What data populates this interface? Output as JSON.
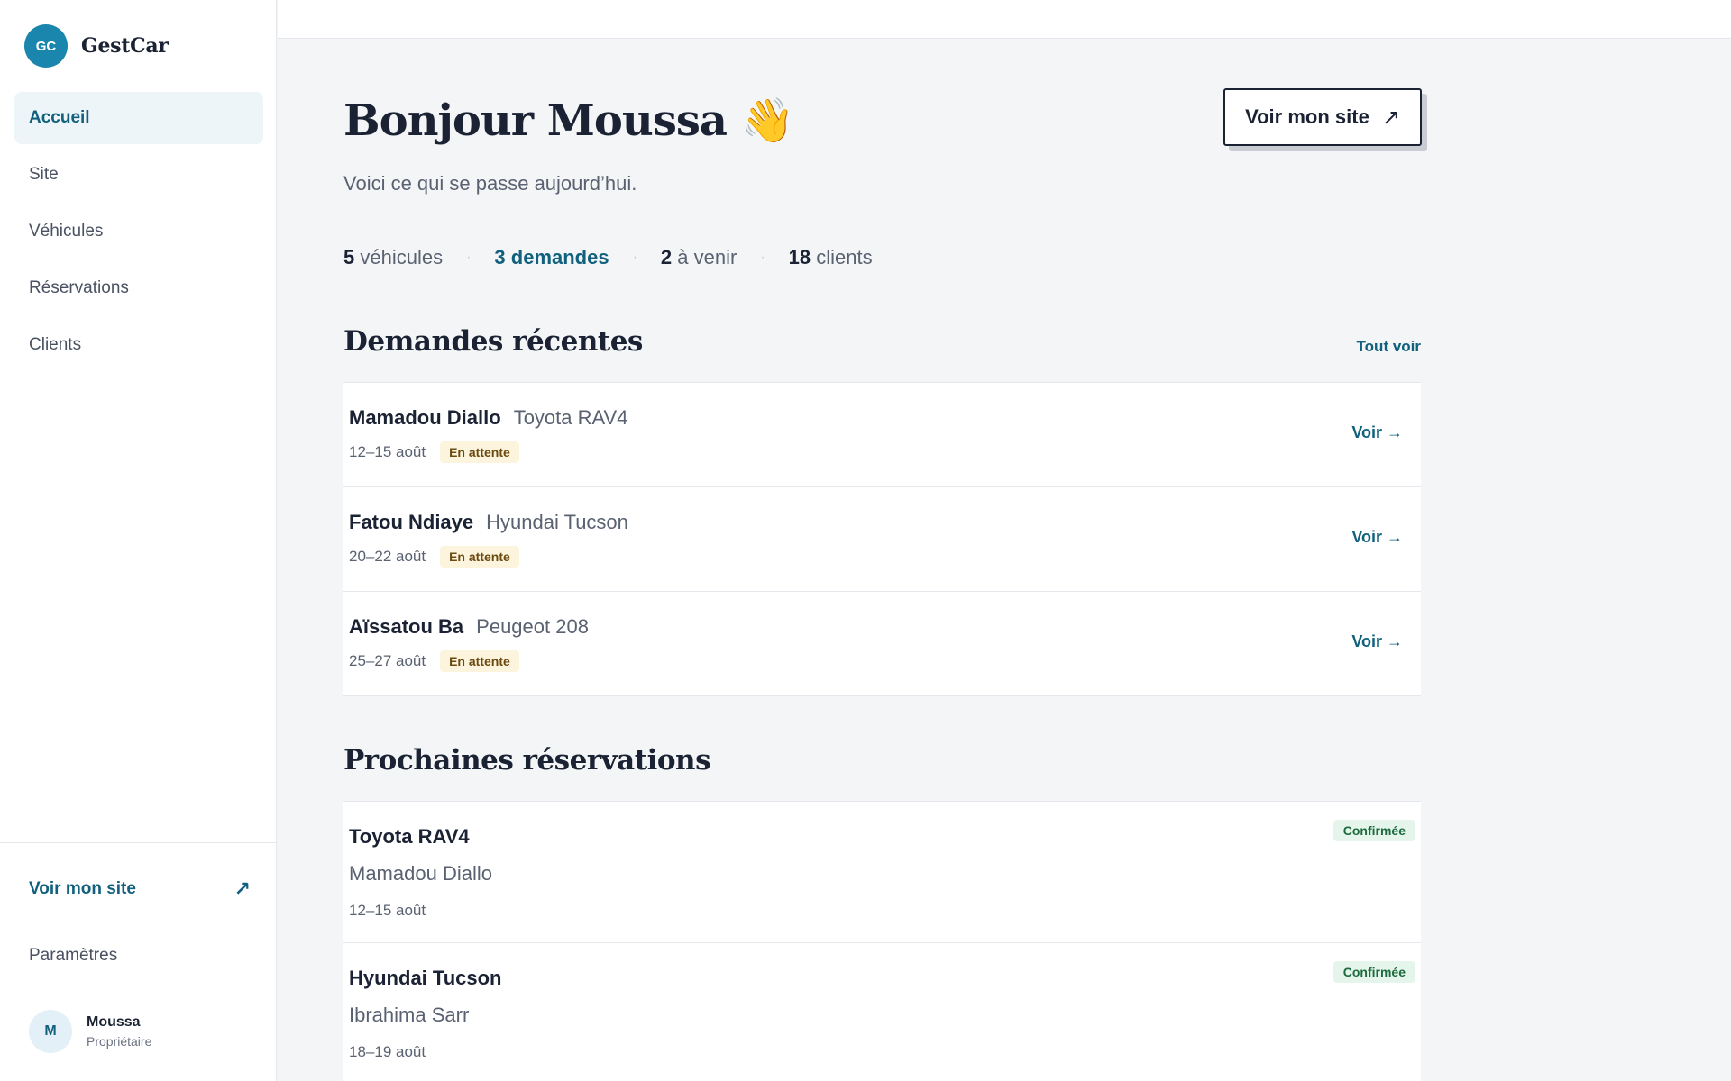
{
  "brand": {
    "initials": "GC",
    "name": "GestCar",
    "color": "#1a86ad"
  },
  "nav": {
    "items": [
      {
        "label": "Accueil",
        "active": true
      },
      {
        "label": "Site",
        "active": false
      },
      {
        "label": "Véhicules",
        "active": false
      },
      {
        "label": "Réservations",
        "active": false
      },
      {
        "label": "Clients",
        "active": false
      }
    ]
  },
  "sidebar_footer": {
    "site_link": "Voir mon site",
    "site_icon": "external-link-icon",
    "settings": "Paramètres",
    "user": {
      "initial": "M",
      "name": "Moussa",
      "role": "Propriétaire"
    }
  },
  "header": {
    "greeting": "Bonjour Moussa",
    "wave_emoji": "👋",
    "subtitle": "Voici ce qui se passe aujourd’hui.",
    "cta_label": "Voir mon site",
    "cta_icon": "↗"
  },
  "stats": [
    {
      "value": "5",
      "label": "véhicules"
    },
    {
      "value": "3 demandes",
      "label": ""
    },
    {
      "value": "2",
      "label": "à venir"
    },
    {
      "value": "18",
      "label": "clients"
    }
  ],
  "requests": {
    "title": "Demandes récentes",
    "see_all": "Tout voir",
    "items": [
      {
        "name": "Mamadou Diallo",
        "car": "Toyota RAV4",
        "dates": "12–15 août",
        "status": "En attente",
        "link": "Voir →"
      },
      {
        "name": "Fatou Ndiaye",
        "car": "Hyundai Tucson",
        "dates": "20–22 août",
        "status": "En attente",
        "link": "Voir →"
      },
      {
        "name": "Aïssatou Ba",
        "car": "Peugeot 208",
        "dates": "25–27 août",
        "status": "En attente",
        "link": "Voir →"
      }
    ]
  },
  "reservations": {
    "title": "Prochaines réservations",
    "items": [
      {
        "car": "Toyota RAV4",
        "client": "Mamadou Diallo",
        "dates": "12–15 août",
        "status": "Confirmée"
      },
      {
        "car": "Hyundai Tucson",
        "client": "Ibrahima Sarr",
        "dates": "18–19 août",
        "status": "Confirmée"
      }
    ]
  },
  "colors": {
    "accent": "#11617e",
    "pending_bg": "#fdf4dd",
    "confirmed_bg": "#e6f5ec"
  }
}
